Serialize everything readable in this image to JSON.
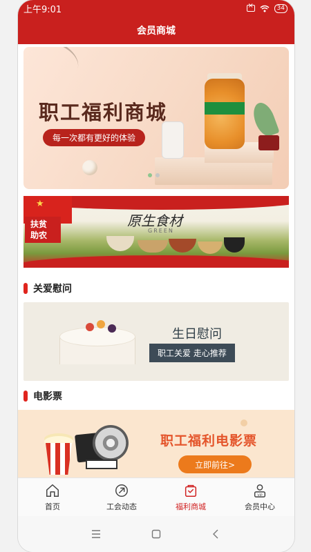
{
  "status_bar": {
    "time": "上午9:01",
    "battery": "34"
  },
  "header": {
    "title": "会员商城"
  },
  "hero": {
    "title": "职工福利商城",
    "subtitle": "每一次都有更好的体验"
  },
  "farm_banner": {
    "tag_line1": "扶贫",
    "tag_line2": "助农",
    "title": "原生食材",
    "green": "GREEN"
  },
  "sections": {
    "care": {
      "title": "关爱慰问"
    },
    "birthday": {
      "title": "生日慰问",
      "subtitle": "职工关爱 走心推荐"
    },
    "movie_section": {
      "title": "电影票"
    },
    "movie": {
      "title": "职工福利电影票",
      "button": "立即前往>"
    }
  },
  "tabs": [
    {
      "label": "首页",
      "icon": "home-icon",
      "active": false
    },
    {
      "label": "工会动态",
      "icon": "news-icon",
      "active": false
    },
    {
      "label": "福利商城",
      "icon": "shopping-bag-icon",
      "active": true
    },
    {
      "label": "会员中心",
      "icon": "vip-user-icon",
      "active": false
    }
  ],
  "colors": {
    "primary": "#c9201e",
    "accent": "#e0241d",
    "tab_active": "#d01f1f",
    "movie_button": "#ec7a1c"
  }
}
